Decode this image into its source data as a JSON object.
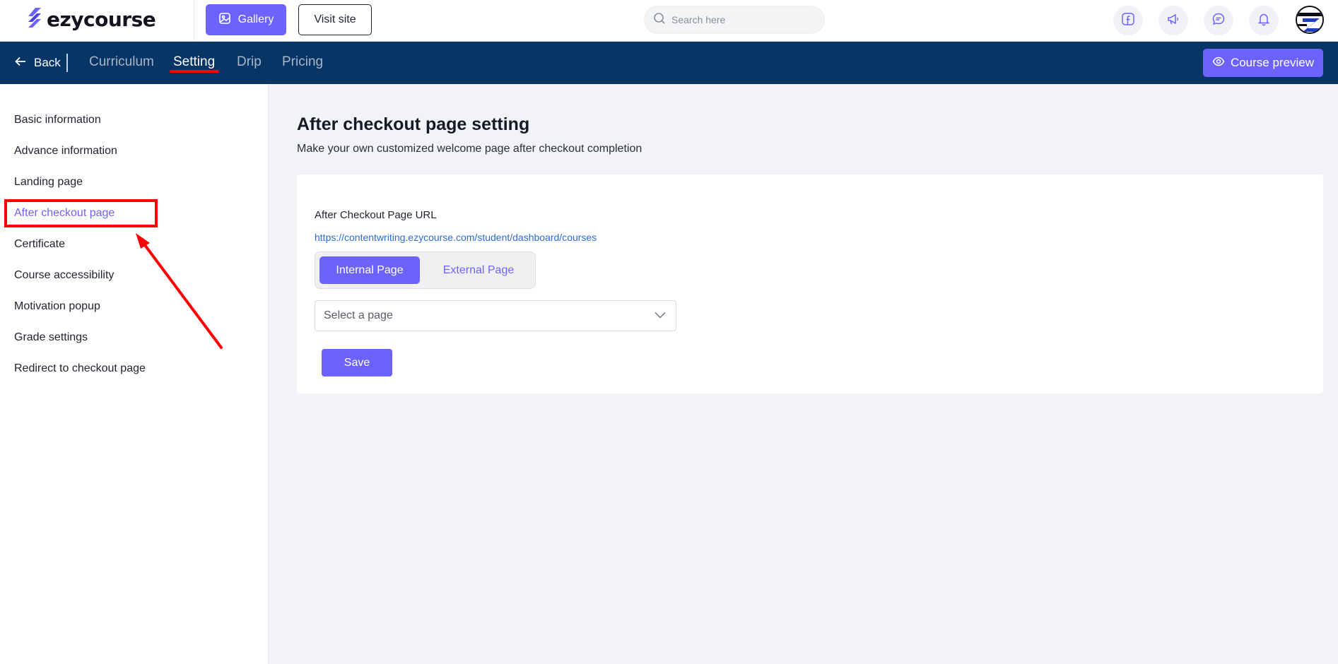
{
  "topbar": {
    "logo_text": "ezycourse",
    "gallery_label": "Gallery",
    "visit_site_label": "Visit site",
    "search_placeholder": "Search here",
    "icons": [
      "facebook-icon",
      "megaphone-icon",
      "chat-icon",
      "bell-icon"
    ]
  },
  "navbar": {
    "back_label": "Back",
    "tabs": [
      {
        "label": "Curriculum",
        "active": false
      },
      {
        "label": "Setting",
        "active": true
      },
      {
        "label": "Drip",
        "active": false
      },
      {
        "label": "Pricing",
        "active": false
      }
    ],
    "preview_label": "Course preview"
  },
  "sidebar": {
    "items": [
      {
        "label": "Basic information",
        "active": false
      },
      {
        "label": "Advance information",
        "active": false
      },
      {
        "label": "Landing page",
        "active": false
      },
      {
        "label": "After checkout page",
        "active": true
      },
      {
        "label": "Certificate",
        "active": false
      },
      {
        "label": "Course accessibility",
        "active": false
      },
      {
        "label": "Motivation popup",
        "active": false
      },
      {
        "label": "Grade settings",
        "active": false
      },
      {
        "label": "Redirect to checkout page",
        "active": false
      }
    ]
  },
  "main": {
    "title": "After checkout page setting",
    "subtitle": "Make your own customized welcome page after checkout completion",
    "field_label": "After Checkout Page URL",
    "url": "https://contentwriting.ezycourse.com/student/dashboard/courses",
    "toggle": {
      "internal_label": "Internal Page",
      "external_label": "External Page",
      "selected": "Internal Page"
    },
    "select_placeholder": "Select a page",
    "save_label": "Save"
  },
  "colors": {
    "accent": "#6c63ff",
    "navbar_bg": "#063566",
    "annotation": "#ff0000",
    "link": "#2b6cd6"
  }
}
